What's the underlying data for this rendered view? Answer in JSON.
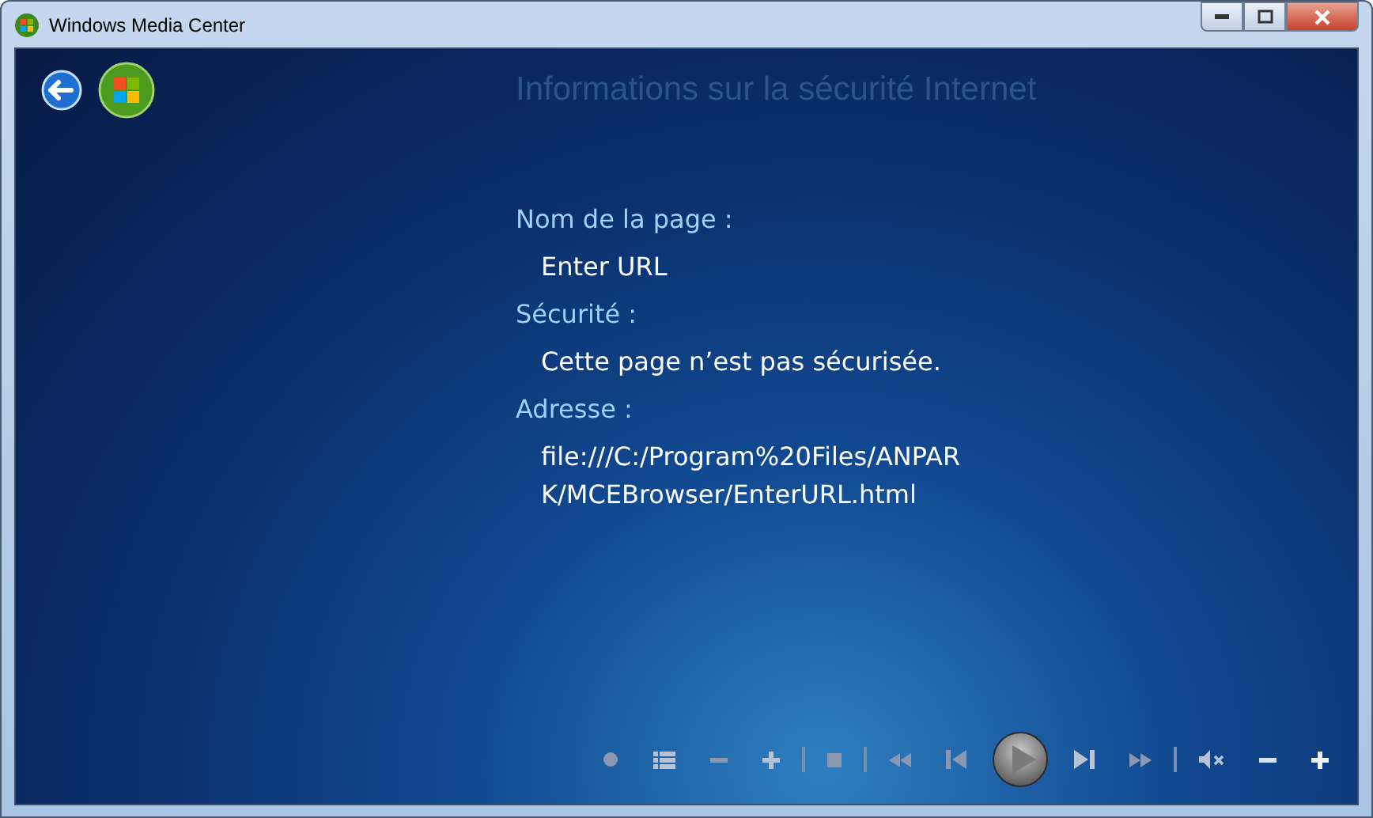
{
  "window": {
    "title": "Windows Media Center"
  },
  "page": {
    "title": "Informations sur la sécurité Internet"
  },
  "fields": [
    {
      "label": "Nom de la page :",
      "lines": [
        "Enter URL"
      ]
    },
    {
      "label": "Sécurité :",
      "lines": [
        "Cette page n’est pas sécurisée."
      ]
    },
    {
      "label": "Adresse :",
      "lines": [
        "file:///C:/Program%20Files/ANPAR",
        "K/MCEBrowser/EnterURL.html"
      ]
    }
  ]
}
